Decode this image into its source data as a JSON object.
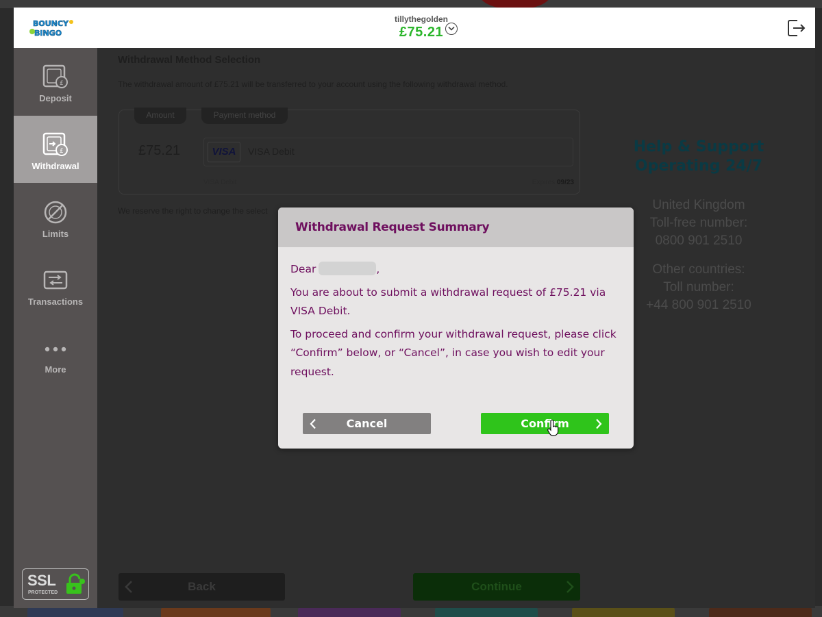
{
  "header": {
    "logo_alt": "Bouncy Bingo",
    "username": "tillythegolden",
    "balance": "£75.21",
    "balance_color": "#2bb52b",
    "icons": {
      "account_menu": "chevron-down-circle-icon",
      "logout": "logout-icon"
    }
  },
  "sidebar": {
    "items": [
      {
        "label": "Deposit",
        "icon": "deposit-icon",
        "active": false
      },
      {
        "label": "Withdrawal",
        "icon": "withdrawal-icon",
        "active": true
      },
      {
        "label": "Limits",
        "icon": "limits-icon",
        "active": false
      },
      {
        "label": "Transactions",
        "icon": "transactions-icon",
        "active": false
      },
      {
        "label": "More",
        "icon": "more-dots-icon",
        "active": false
      }
    ],
    "ssl": {
      "main": "SSL",
      "sub": "PROTECTED"
    }
  },
  "main": {
    "title": "Withdrawal Method Selection",
    "description": "The withdrawal amount of £75.21 will be transferred to your account using the following withdrawal method.",
    "card": {
      "amount_tab": "Amount",
      "method_tab": "Payment method",
      "amount": "£75.21",
      "method_logo": "VISA",
      "method_name": "VISA Debit",
      "masked_label": "VISA Debit",
      "expires_label": "Expires",
      "expires_value": "09/23"
    },
    "reserve_note": "We reserve the right to change the select",
    "back_label": "Back",
    "continue_label": "Continue"
  },
  "help": {
    "title_line1": "Help & Support",
    "title_line2": "Operating 24/7",
    "uk_label": "United Kingdom",
    "uk_toll_free_label": "Toll-free number:",
    "uk_number": "0800 901 2510",
    "other_label": "Other countries:",
    "other_toll_label": "Toll number:",
    "other_number": "+44 800 901 2510"
  },
  "modal": {
    "title": "Withdrawal Request Summary",
    "greeting": "Dear",
    "greeting_suffix": ",",
    "line1": "You are about to submit a withdrawal request of £75.21 via VISA Debit.",
    "line2": "To proceed and confirm your withdrawal request, please click “Confirm” below, or “Cancel”, in case you wish to edit your request.",
    "cancel_label": "Cancel",
    "confirm_label": "Confirm",
    "accent_color": "#6e0f5e",
    "confirm_color": "#2fc41b"
  }
}
